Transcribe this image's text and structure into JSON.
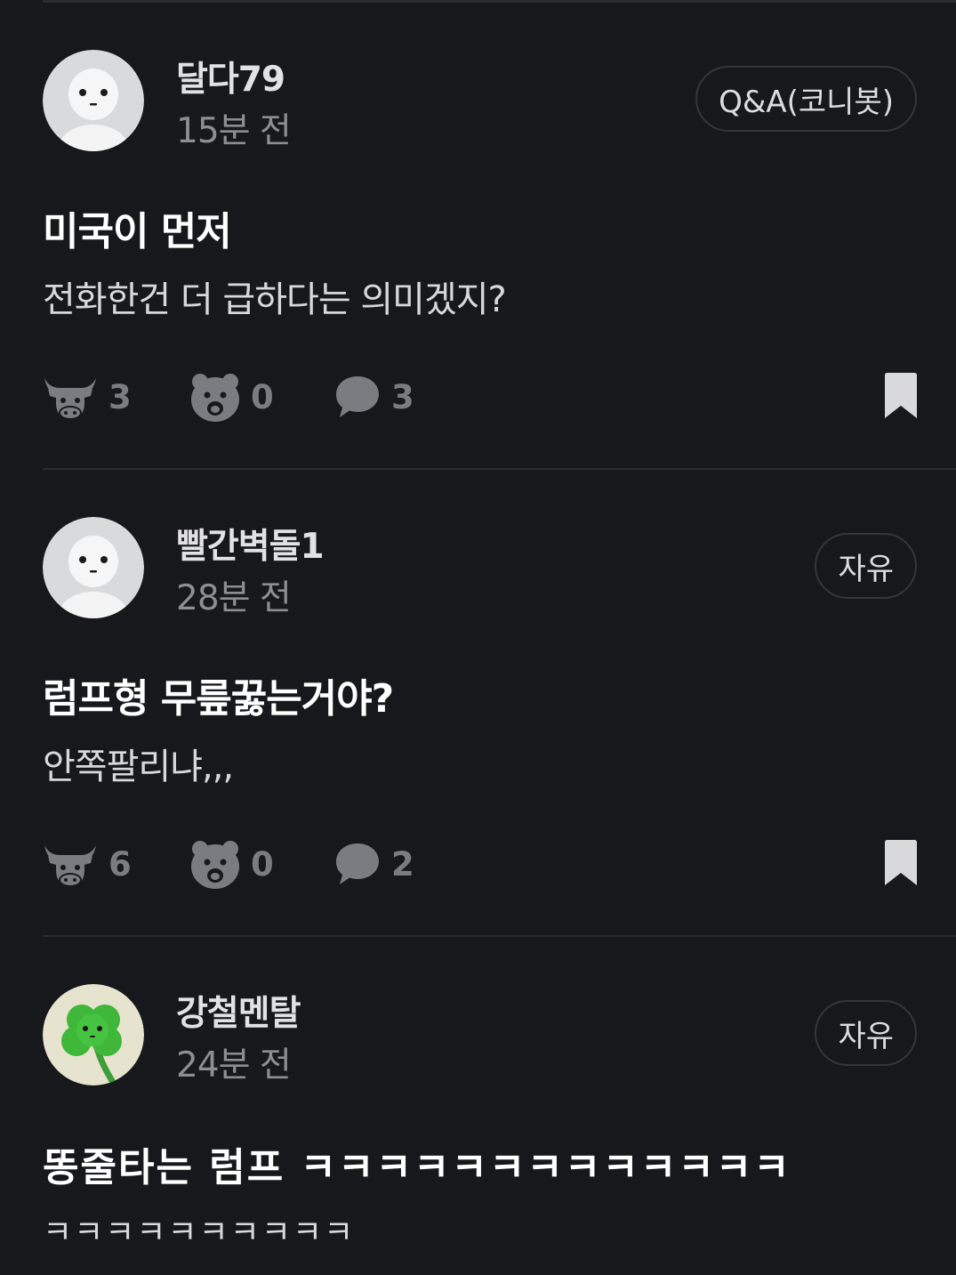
{
  "posts": [
    {
      "author": "달다79",
      "time": "15분 전",
      "category": "Q&A(코니봇)",
      "title": "미국이 먼저",
      "body": "전화한건 더 급하다는 의미겠지?",
      "likes": "3",
      "dislikes": "0",
      "comments": "3",
      "avatar": "white-character-avatar"
    },
    {
      "author": "빨간벽돌1",
      "time": "28분 전",
      "category": "자유",
      "title": "럼프형 무릎꿇는거야?",
      "body": "안쪽팔리냐,,,",
      "likes": "6",
      "dislikes": "0",
      "comments": "2",
      "avatar": "white-character-avatar"
    },
    {
      "author": "강철멘탈",
      "time": "24분 전",
      "category": "자유",
      "title": "똥줄타는 럼프 ㅋㅋㅋㅋㅋㅋㅋㅋㅋㅋㅋㅋㅋ",
      "body": "ㅋㅋㅋㅋㅋㅋㅋㅋㅋㅋ",
      "avatar": "clover-avatar"
    }
  ],
  "icons": {
    "like": "bull-icon",
    "dislike": "bear-icon",
    "comment": "speech-bubble-icon",
    "bookmark": "bookmark-icon"
  },
  "colors": {
    "background": "#17181b",
    "divider": "#2a2b2f",
    "muted": "#7b7c82",
    "bookmark": "#d9d9db"
  }
}
